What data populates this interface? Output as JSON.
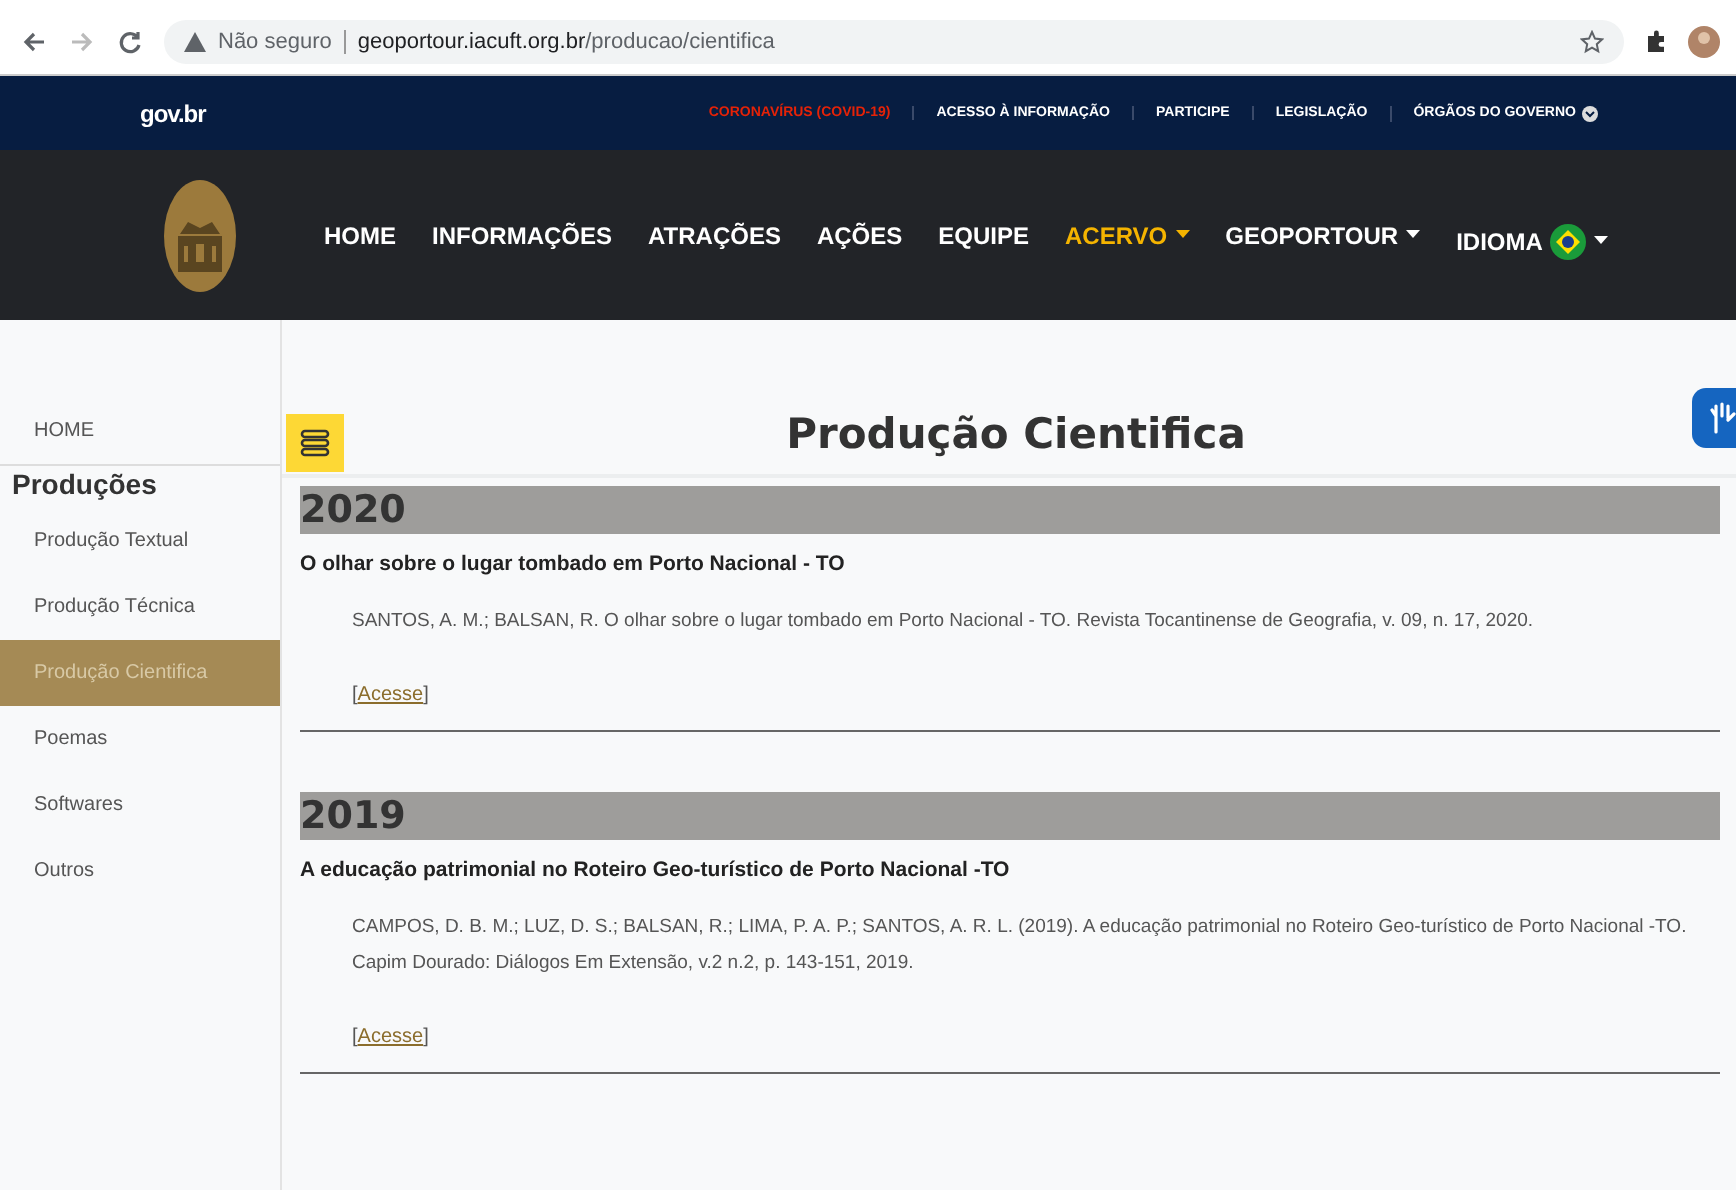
{
  "browser": {
    "security": "Não seguro",
    "url_host": "geoportour.iacuft.org.br",
    "url_path": "/producao/cientifica"
  },
  "gov_bar": {
    "logo": "gov.br",
    "links": [
      {
        "label": "CORONAVÍRUS (COVID-19)",
        "kind": "alert"
      },
      {
        "label": "ACESSO À INFORMAÇÃO",
        "kind": "plain"
      },
      {
        "label": "PARTICIPE",
        "kind": "plain"
      },
      {
        "label": "LEGISLAÇÃO",
        "kind": "plain"
      },
      {
        "label": "ÓRGÃOS DO GOVERNO",
        "kind": "menu"
      }
    ]
  },
  "nav": {
    "items": [
      {
        "label": "HOME",
        "selected": false,
        "dropdown": false
      },
      {
        "label": "INFORMAÇÕES",
        "selected": false,
        "dropdown": false
      },
      {
        "label": "ATRAÇÕES",
        "selected": false,
        "dropdown": false
      },
      {
        "label": "AÇÕES",
        "selected": false,
        "dropdown": false
      },
      {
        "label": "EQUIPE",
        "selected": false,
        "dropdown": false
      },
      {
        "label": "ACERVO",
        "selected": true,
        "dropdown": true
      },
      {
        "label": "GEOPORTOUR",
        "selected": false,
        "dropdown": true
      }
    ],
    "language": "IDIOMA"
  },
  "sidebar": {
    "home": "HOME",
    "heading": "Produções",
    "items": [
      {
        "label": "Produção Textual",
        "selected": false
      },
      {
        "label": "Produção Técnica",
        "selected": false
      },
      {
        "label": "Produção Cientifica",
        "selected": true
      },
      {
        "label": "Poemas",
        "selected": false
      },
      {
        "label": "Softwares",
        "selected": false
      },
      {
        "label": "Outros",
        "selected": false
      }
    ]
  },
  "page_title": "Produção Cientifica",
  "sections": [
    {
      "year": "2020",
      "entries": [
        {
          "title": "O olhar sobre o lugar tombado em Porto Nacional - TO",
          "citation": "SANTOS, A. M.; BALSAN, R. O olhar sobre o lugar tombado em Porto Nacional - TO. Revista Tocantinense de Geografia, v. 09, n. 17, 2020.",
          "link_open": "[",
          "link": "Acesse",
          "link_close": "]"
        }
      ]
    },
    {
      "year": "2019",
      "entries": [
        {
          "title": "A educação patrimonial no Roteiro Geo-turístico de Porto Nacional -TO",
          "citation": "CAMPOS, D. B. M.; LUZ, D. S.; BALSAN, R.; LIMA, P. A. P.; SANTOS, A. R. L. (2019). A educação patrimonial no Roteiro Geo-turístico de Porto Nacional -TO. Capim Dourado: Diálogos Em Extensão, v.2 n.2, p. 143-151, 2019.",
          "link_open": "[",
          "link": "Acesse",
          "link_close": "]"
        }
      ]
    }
  ]
}
